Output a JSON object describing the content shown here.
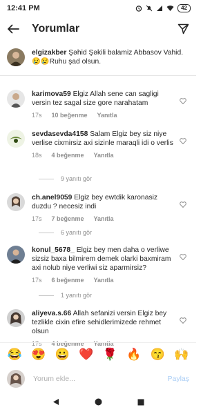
{
  "status": {
    "time": "12:41 PM",
    "battery": "42"
  },
  "header": {
    "title": "Yorumlar"
  },
  "caption": {
    "username": "elgizakber",
    "text": "Şəhid Şəkili balamiz Abbasov Vahid. 😢😢Ruhu şad olsun."
  },
  "comments": [
    {
      "username": "karimova59",
      "text": "Elgiz Allah sene can sagligi versin tez sagal size gore narahatam",
      "time": "17s",
      "likes": "10 beğenme",
      "reply": "Yanıtla"
    },
    {
      "username": "sevdasevda4158",
      "text": "Salam Elgiz bey siz niye verlise cixmirsiz axi sizinle maraqli idi o verlis",
      "time": "18s",
      "likes": "4 beğenme",
      "reply": "Yanıtla",
      "replies": "9 yanıtı gör"
    },
    {
      "username": "ch.anel9059",
      "text": "Elgiz bey ewtdik karonasiz duzdu ? necesiz indi",
      "time": "17s",
      "likes": "7 beğenme",
      "reply": "Yanıtla",
      "replies": "6 yanıtı gör"
    },
    {
      "username": "konul_5678_",
      "text": "Elgiz bey men daha o verliwe sizsiz baxa bilmirem demek olarki baxmiram axi nolub niye verliwi siz aparmirsiz?",
      "time": "17s",
      "likes": "6 beğenme",
      "reply": "Yanıtla",
      "replies": "1 yanıtı gör"
    },
    {
      "username": "aliyeva.s.66",
      "text": "Allah sefanizi versin Elgiz bey tezlikle cixin efire  sehidlerimizede rehmet olsun",
      "time": "17s",
      "likes": "4 beğenme",
      "reply": "Yanıtla"
    }
  ],
  "emojis": [
    "😂",
    "😍",
    "😀",
    "❤️",
    "🌹",
    "🔥",
    "😙",
    "🙌"
  ],
  "input": {
    "placeholder": "Yorum ekle...",
    "share": "Paylaş"
  },
  "colors": {
    "accent_disabled": "#a9cdf5",
    "text": "#262626",
    "meta": "#8e8e8e"
  }
}
